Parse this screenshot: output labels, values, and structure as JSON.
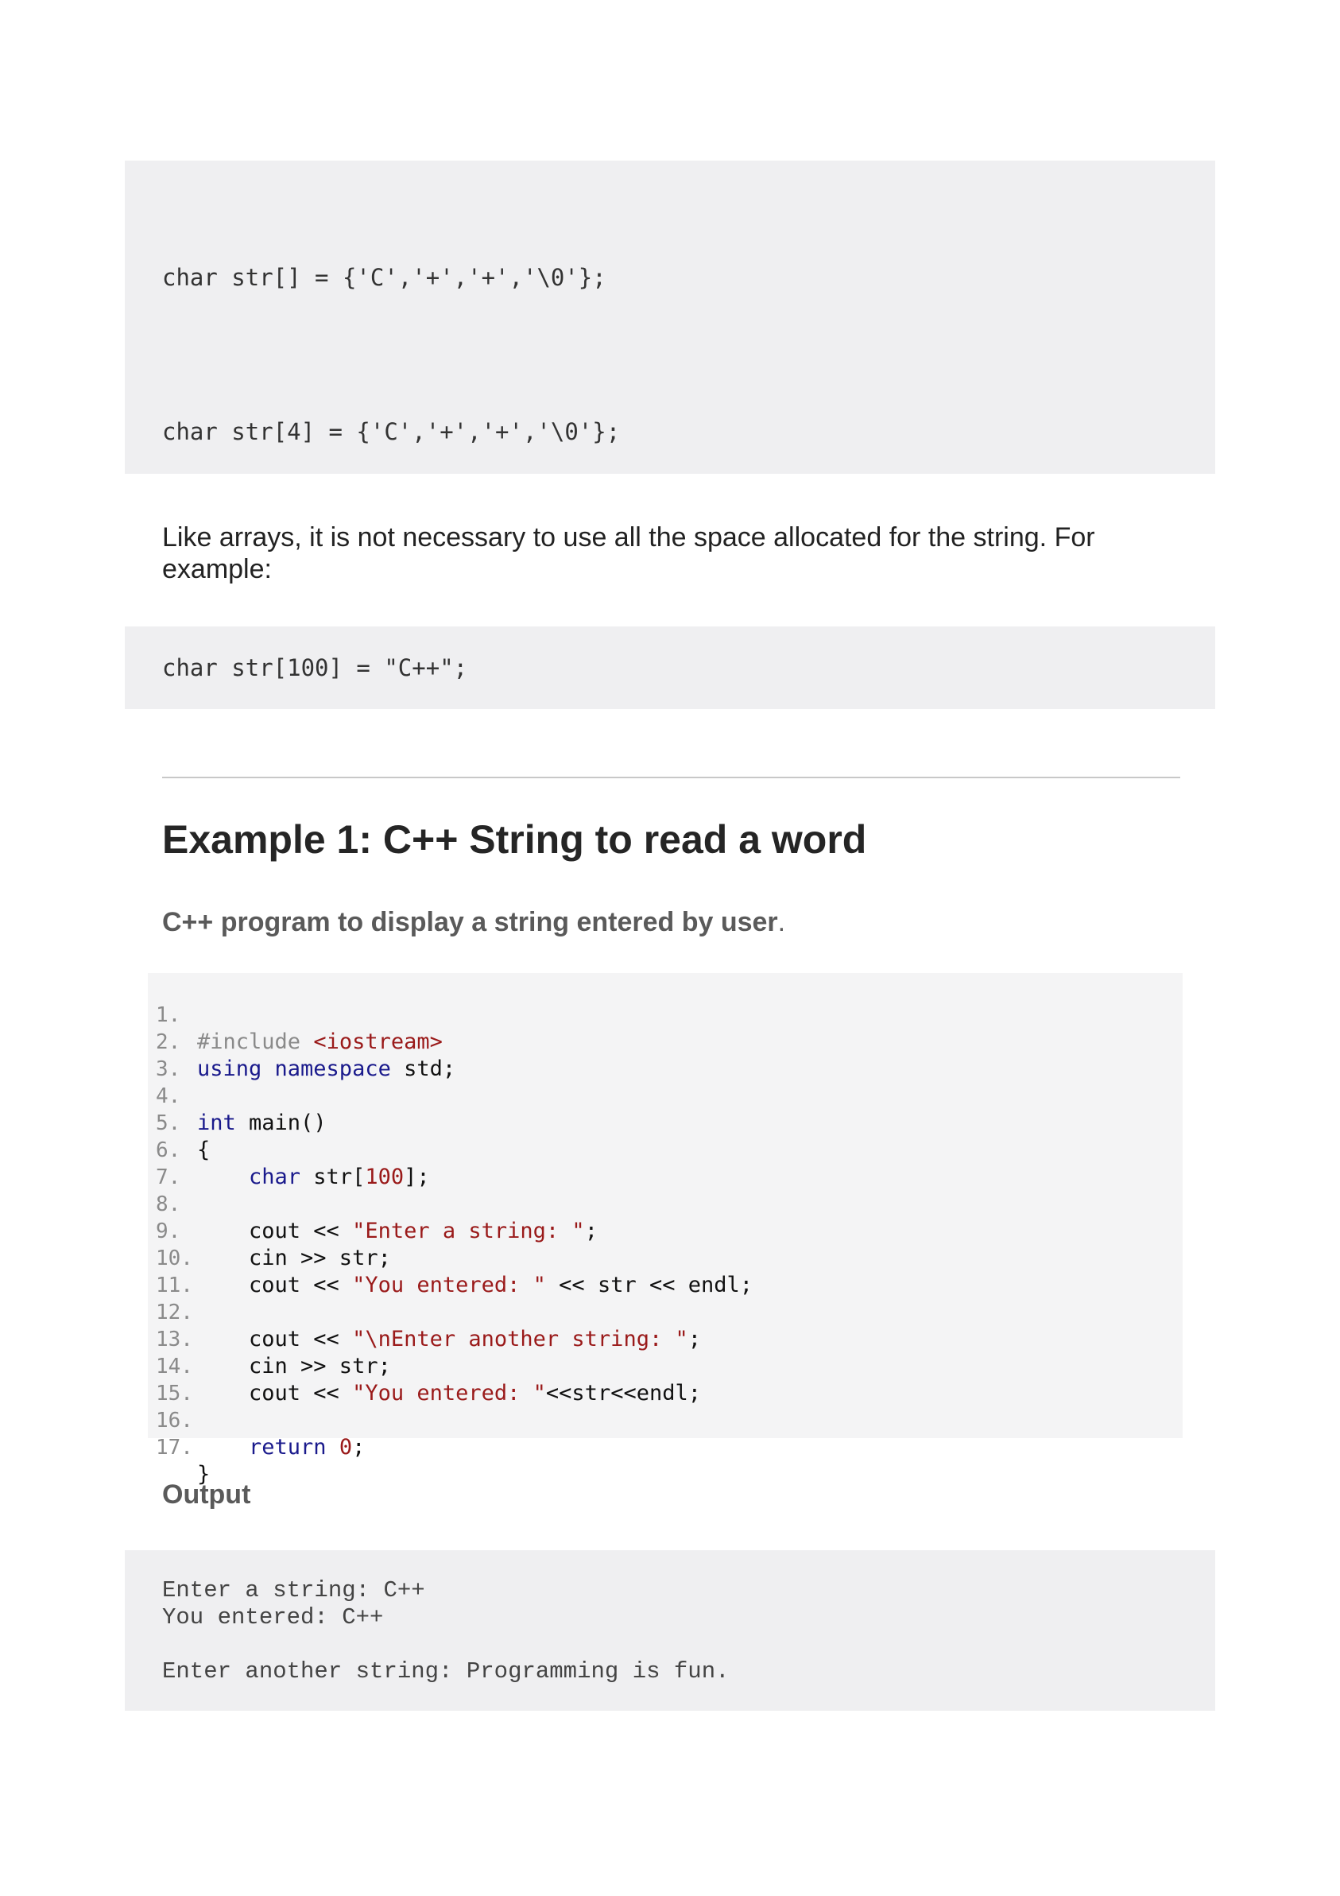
{
  "code_block_1": {
    "line_1": "char str[] = {'C','+','+','\\0'};",
    "line_2": "char str[4] = {'C','+','+','\\0'};"
  },
  "paragraph_1": "Like arrays, it is not necessary to use all the space allocated for the string. For example:",
  "code_block_2": {
    "line_1": "char str[100] = \"C++\";"
  },
  "example_heading": "Example 1: C++ String to read a word",
  "example_subheading": "C++ program to display a string entered by user",
  "example_subheading_punct": ".",
  "listing": {
    "numbers": [
      "1.",
      "2.",
      "3.",
      "4.",
      "5.",
      "6.",
      "7.",
      "8.",
      "9.",
      "10.",
      "11.",
      "12.",
      "13.",
      "14.",
      "15.",
      "16.",
      "17."
    ],
    "l1_pp": "#include ",
    "l1_str": "<iostream>",
    "l2_kw": "using namespace",
    "l2_rest": " std;",
    "l4_kw": "int",
    "l4_rest": " main()",
    "l5": "{",
    "l6_kw": "    char",
    "l6_a": " str[",
    "l6_num": "100",
    "l6_b": "];",
    "l8_a": "    cout << ",
    "l8_str": "\"Enter a string: \"",
    "l8_b": ";",
    "l9": "    cin >> str;",
    "l10_a": "    cout << ",
    "l10_str": "\"You entered: \"",
    "l10_b": " << str << endl;",
    "l12_a": "    cout << ",
    "l12_str": "\"\\nEnter another string: \"",
    "l12_b": ";",
    "l13": "    cin >> str;",
    "l14_a": "    cout << ",
    "l14_str": "\"You entered: \"",
    "l14_b": "<<str<<endl;",
    "l16_kw": "    return",
    "l16_a": " ",
    "l16_num": "0",
    "l16_b": ";",
    "l17": "}"
  },
  "output_heading": "Output",
  "output_block": {
    "line_1": "Enter a string: C++",
    "line_2": "You entered: C++",
    "line_3": "Enter another string: Programming is fun."
  }
}
